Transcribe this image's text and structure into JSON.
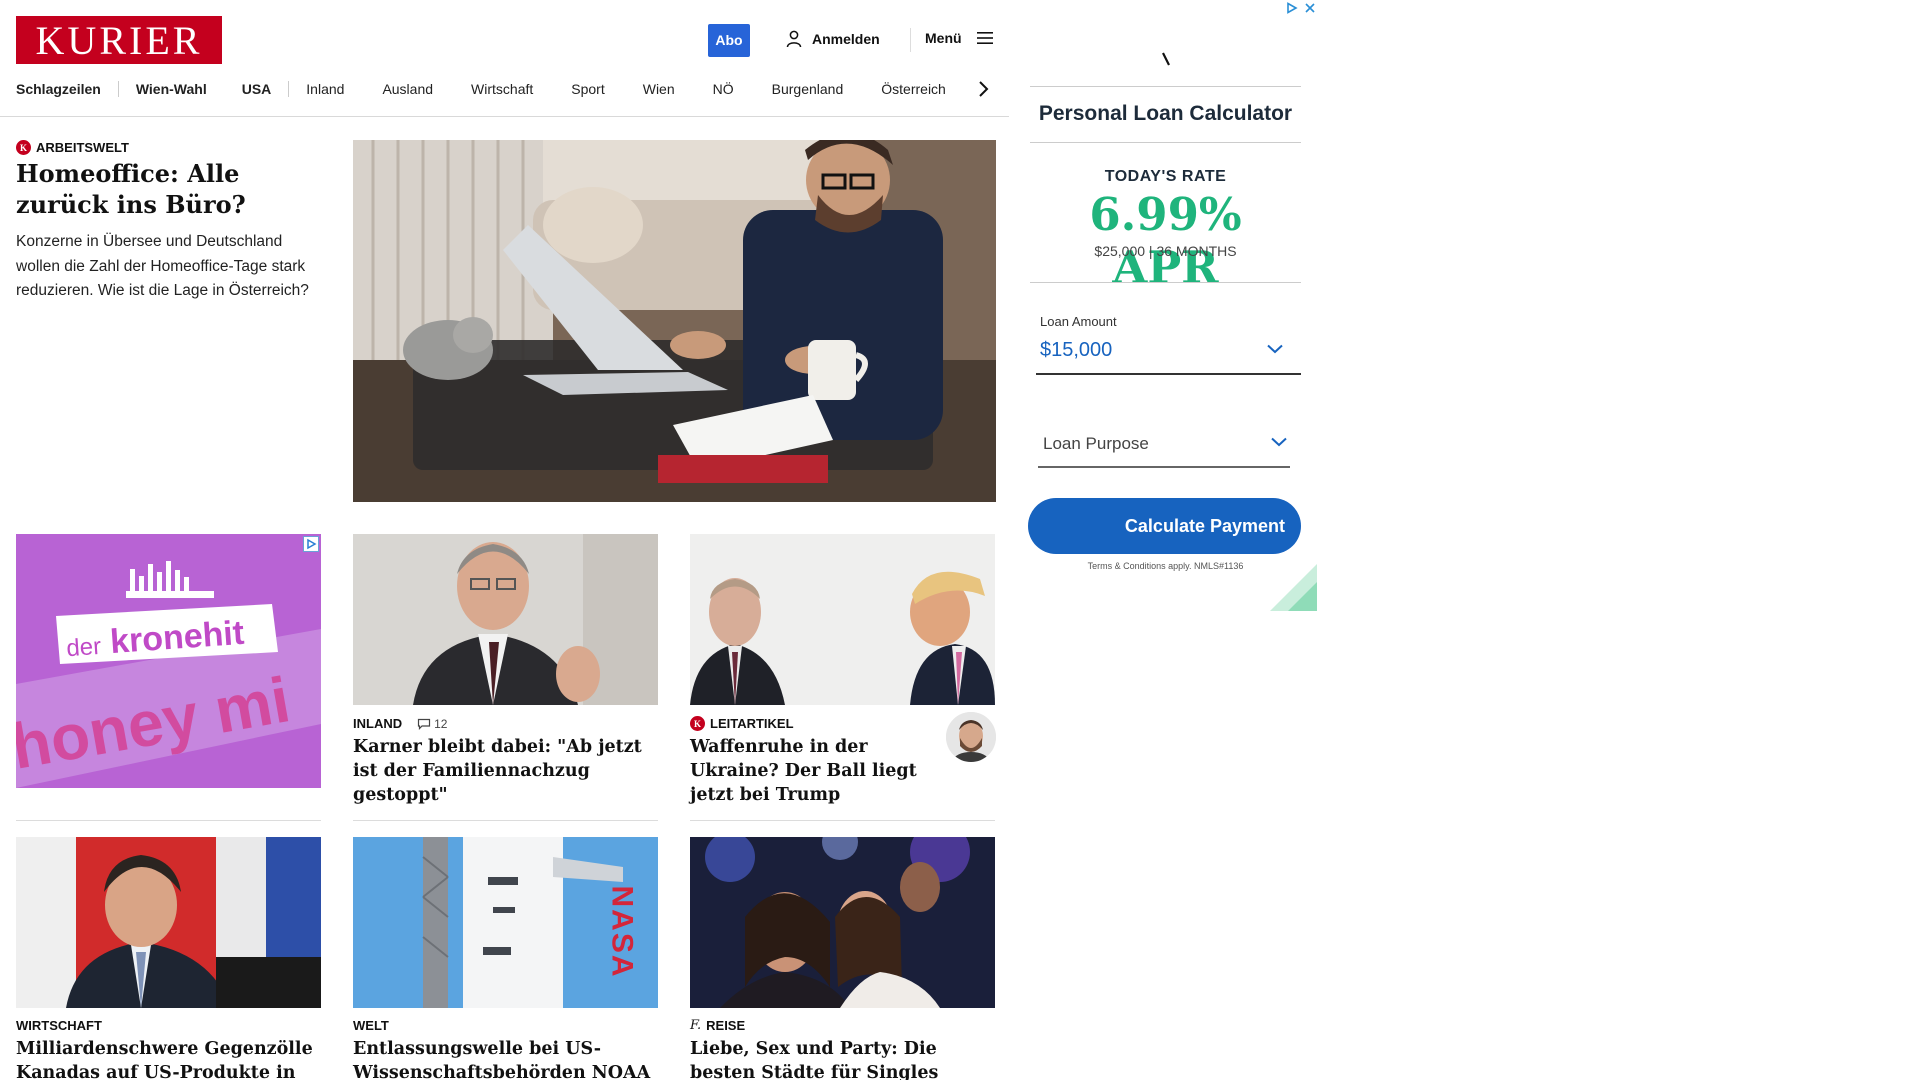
{
  "header": {
    "logo": "KURIER",
    "abo": "Abo",
    "login": "Anmelden",
    "menu": "Menü"
  },
  "nav": {
    "items": [
      "Schlagzeilen",
      "Wien-Wahl",
      "USA",
      "Inland",
      "Ausland",
      "Wirtschaft",
      "Sport",
      "Wien",
      "NÖ",
      "Burgenland",
      "Österreich"
    ]
  },
  "lead": {
    "kicker": "ARBEITSWELT",
    "title": "Homeoffice: Alle zurück ins Büro?",
    "teaser": "Konzerne in Übersee und Deutschland wollen die Zahl der Homeoffice-Tage stark reduzieren. Wie ist die Lage in Österreich?"
  },
  "ad_kronehit": {
    "brand_prefix": "der",
    "brand": "kronehit",
    "slogan": "honey mi"
  },
  "cards": [
    {
      "kicker": "INLAND",
      "comments": "12",
      "title": "Karner bleibt dabei: \"Ab jetzt ist der Familiennachzug gestoppt\""
    },
    {
      "kicker": "LEITARTIKEL",
      "title": "Waffenruhe in der Ukraine? Der Ball liegt jetzt bei Trump"
    },
    {
      "kicker": "WIRTSCHAFT",
      "title": "Milliardenschwere Gegenzölle Kanadas auf US-Produkte in Kraft"
    },
    {
      "kicker": "WELT",
      "title": "Entlassungswelle bei US-Wissenschaftsbehörden NOAA und NASA"
    },
    {
      "kicker": "REISE",
      "title": "Liebe, Sex und Party: Die besten Städte für Singles"
    }
  ],
  "ad_loan": {
    "title": "Personal Loan Calculator",
    "rate_label": "TODAY'S RATE",
    "rate_value": "6.99% APR",
    "rate_sub": "$25,000 | 36 MONTHS",
    "amount_label": "Loan Amount",
    "amount_value": "$15,000",
    "purpose_placeholder": "Loan Purpose",
    "button": "Calculate Payment",
    "terms": "Terms & Conditions apply. NMLS#1136"
  },
  "colors": {
    "brand_red": "#c4001e",
    "abo_blue": "#2764d8",
    "loan_green": "#1fb47c",
    "loan_blue": "#1763bf"
  }
}
